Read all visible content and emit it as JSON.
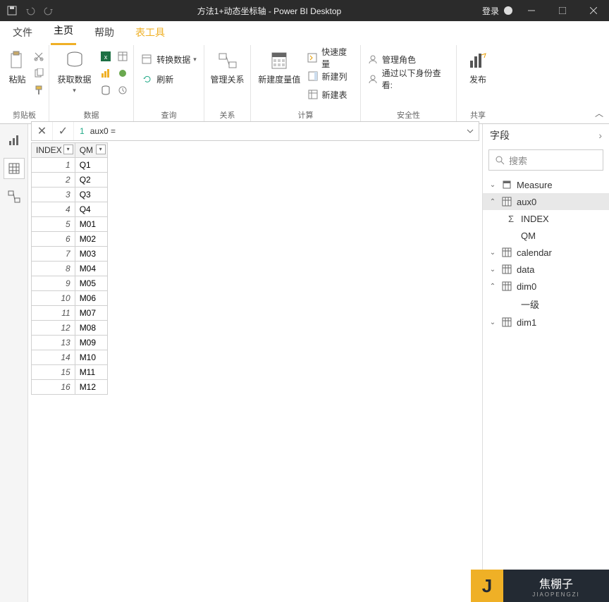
{
  "title": "方法1+动态坐标轴 - Power BI Desktop",
  "account_label": "登录",
  "tabs": {
    "file": "文件",
    "home": "主页",
    "help": "帮助",
    "tabletools": "表工具"
  },
  "ribbon": {
    "clipboard": {
      "paste": "粘贴",
      "group": "剪贴板"
    },
    "data": {
      "getdata": "获取数据",
      "group": "数据"
    },
    "query": {
      "transform": "转换数据",
      "refresh": "刷新",
      "group": "查询"
    },
    "relations": {
      "manage": "管理关系",
      "group": "关系"
    },
    "calc": {
      "newmeasure": "新建度量值",
      "quickmeasure": "快速度量",
      "newcolumn": "新建列",
      "newtable": "新建表",
      "group": "计算"
    },
    "security": {
      "roles": "管理角色",
      "viewas": "通过以下身份查看:",
      "group": "安全性"
    },
    "share": {
      "publish": "发布",
      "group": "共享"
    }
  },
  "formula": {
    "line": "1",
    "text": "aux0 ="
  },
  "columns": {
    "index": "INDEX",
    "qm": "QM"
  },
  "rows": [
    {
      "i": "1",
      "q": "Q1"
    },
    {
      "i": "2",
      "q": "Q2"
    },
    {
      "i": "3",
      "q": "Q3"
    },
    {
      "i": "4",
      "q": "Q4"
    },
    {
      "i": "5",
      "q": "M01"
    },
    {
      "i": "6",
      "q": "M02"
    },
    {
      "i": "7",
      "q": "M03"
    },
    {
      "i": "8",
      "q": "M04"
    },
    {
      "i": "9",
      "q": "M05"
    },
    {
      "i": "10",
      "q": "M06"
    },
    {
      "i": "11",
      "q": "M07"
    },
    {
      "i": "12",
      "q": "M08"
    },
    {
      "i": "13",
      "q": "M09"
    },
    {
      "i": "14",
      "q": "M10"
    },
    {
      "i": "15",
      "q": "M11"
    },
    {
      "i": "16",
      "q": "M12"
    }
  ],
  "fields": {
    "title": "字段",
    "search": "搜索",
    "items": [
      {
        "exp": "▾",
        "type": "measure",
        "name": "Measure"
      },
      {
        "exp": "▴",
        "type": "table",
        "name": "aux0",
        "sel": true
      },
      {
        "leaf": true,
        "sigma": true,
        "name": "INDEX"
      },
      {
        "leaf": true,
        "name": "QM"
      },
      {
        "exp": "▾",
        "type": "table",
        "name": "calendar"
      },
      {
        "exp": "▾",
        "type": "table",
        "name": "data"
      },
      {
        "exp": "▴",
        "type": "table",
        "name": "dim0"
      },
      {
        "leaf": true,
        "name": "一级"
      },
      {
        "exp": "▾",
        "type": "table",
        "name": "dim1"
      }
    ]
  },
  "watermark": {
    "zh": "焦棚子",
    "py": "JIAOPENGZI"
  }
}
